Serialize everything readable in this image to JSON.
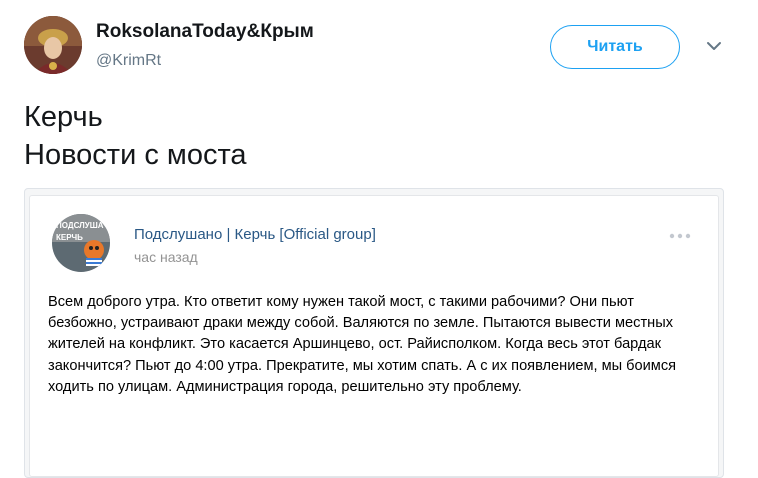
{
  "tweet": {
    "author_name": "RoksolanaToday&Крым",
    "author_handle": "@KrimRt",
    "follow_label": "Читать",
    "text_line1": "Керчь",
    "text_line2": "Новости с моста"
  },
  "embedded_post": {
    "group_name": "Подслушано | Керчь [Official group]",
    "time": "час назад",
    "text": "Всем доброго утра. Кто ответит кому нужен такой мост, с такими рабочими? Они пьют безбожно, устраивают драки между собой. Валяются по земле. Пытаются вывести местных жителей на конфликт. Это касается Аршинцево, ост. Райисполком. Когда весь этот бардак закончится? Пьют до 4:00 утра. Прекратите, мы хотим спать. А с их появлением, мы боимся ходить по улицам. Администрация города, решительно эту проблему.",
    "avatar_text": "ПОДСЛУШАНО КЕРЧЬ"
  },
  "colors": {
    "accent": "#1da1f2",
    "vk_link": "#2a5885",
    "muted": "#657786"
  },
  "icons": {
    "chevron": "chevron-down-icon",
    "more": "more-dots-icon"
  }
}
